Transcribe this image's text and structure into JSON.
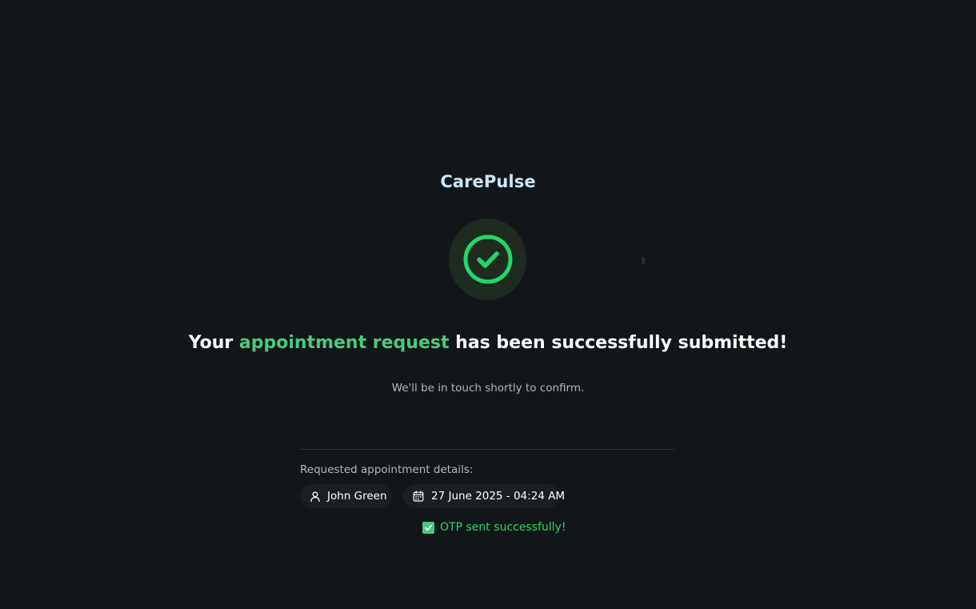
{
  "app": {
    "name": "CarePulse"
  },
  "success": {
    "icon": "check-circle-icon",
    "headline_prefix": "Your",
    "headline_accent": "appointment request",
    "headline_suffix": "has been successfully submitted!",
    "subtext": "We'll be in touch shortly to confirm."
  },
  "details": {
    "label": "Requested appointment details:",
    "patient": {
      "icon": "user-icon",
      "name": "John Green"
    },
    "schedule": {
      "icon": "calendar-icon",
      "datetime": "27 June 2025 - 04:24 AM"
    }
  },
  "toast": {
    "icon": "checkbox-checked-icon",
    "message": "OTP sent successfully!"
  },
  "colors": {
    "background": "#131619",
    "brand": "#cbe6f6",
    "accent_green": "#4ac97e",
    "success_ring": "#24d668",
    "muted_text": "#abb8c4",
    "chip_bg": "#1c1f22"
  }
}
